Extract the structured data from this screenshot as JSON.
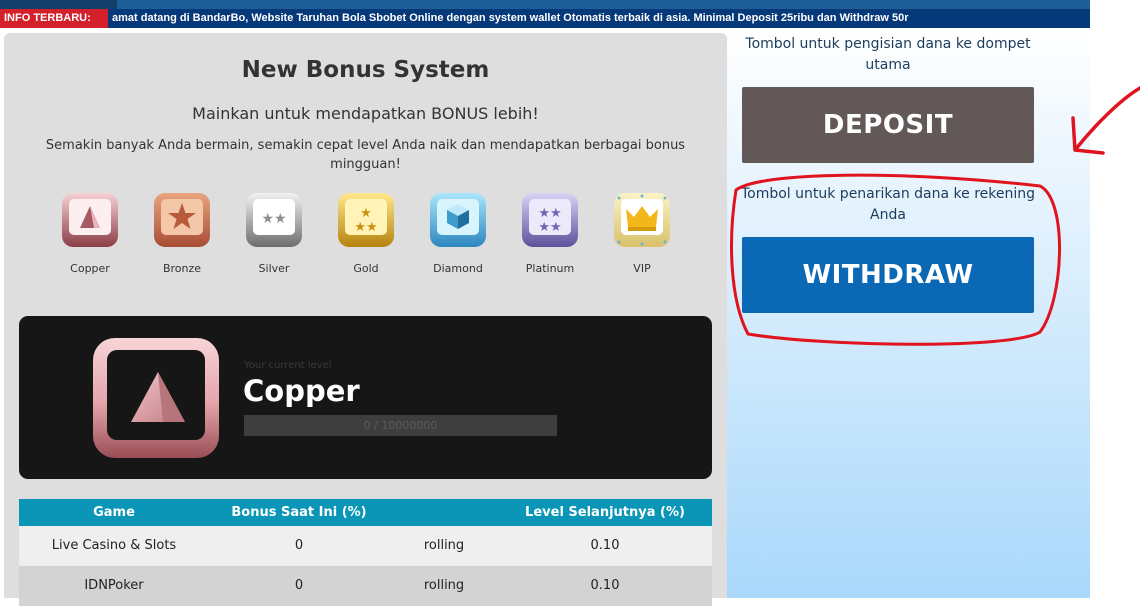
{
  "ticker": {
    "label": "INFO TERBARU:",
    "text": "amat datang di BandarBo, Website Taruhan Bola Sbobet Online dengan system wallet Otomatis terbaik di asia. Minimal Deposit 25ribu dan Withdraw 50r"
  },
  "bonus": {
    "title": "New Bonus System",
    "subtitle": "Mainkan untuk mendapatkan BONUS lebih!",
    "description": "Semakin banyak Anda bermain, semakin cepat level Anda naik dan mendapatkan berbagai bonus mingguan!",
    "levels": [
      {
        "name": "Copper",
        "icon": "copper-pyramid-icon",
        "color": "#c9848a"
      },
      {
        "name": "Bronze",
        "icon": "bronze-star-icon",
        "color": "#c8674f"
      },
      {
        "name": "Silver",
        "icon": "silver-stars-icon",
        "color": "#9a9a9a"
      },
      {
        "name": "Gold",
        "icon": "gold-stars-icon",
        "color": "#d9a92c"
      },
      {
        "name": "Diamond",
        "icon": "diamond-cube-icon",
        "color": "#3a9fd1"
      },
      {
        "name": "Platinum",
        "icon": "platinum-stars-icon",
        "color": "#7a70b8"
      },
      {
        "name": "VIP",
        "icon": "vip-crown-icon",
        "color": "#e0b21a"
      }
    ]
  },
  "current": {
    "label": "Your current level",
    "level": "Copper",
    "progress_text": "0 / 10000000",
    "progress_fraction": 0
  },
  "table": {
    "headers": [
      "Game",
      "Bonus Saat Ini (%)",
      "",
      "Level Selanjutnya (%)"
    ],
    "rows": [
      {
        "game": "Live Casino & Slots",
        "bonus": "0",
        "type": "rolling",
        "next": "0.10"
      },
      {
        "game": "IDNPoker",
        "bonus": "0",
        "type": "rolling",
        "next": "0.10"
      }
    ]
  },
  "sidebar": {
    "deposit_hint": "Tombol untuk pengisian dana ke dompet utama",
    "deposit_label": "DEPOSIT",
    "withdraw_hint": "Tombol untuk penarikan dana ke rekening Anda",
    "withdraw_label": "WITHDRAW"
  },
  "colors": {
    "ticker_bg": "#06397a",
    "ticker_label": "#d3202a",
    "table_header": "#0b95b6",
    "deposit": "#625858",
    "withdraw": "#0a68b5",
    "annotation": "#e0141e"
  }
}
